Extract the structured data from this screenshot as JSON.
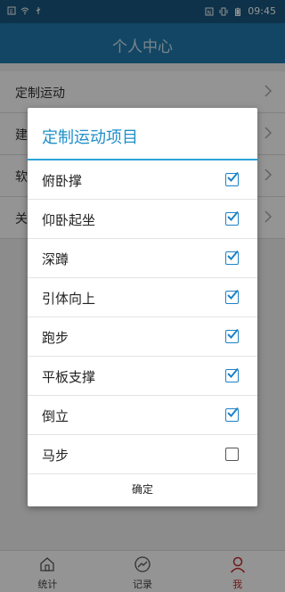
{
  "status_bar": {
    "time": "09:45",
    "icons": [
      "notification-icon",
      "wifi-icon",
      "usb-icon",
      "nfc-icon",
      "vibrate-icon",
      "battery-icon"
    ]
  },
  "header": {
    "title": "个人中心"
  },
  "settings": {
    "items": [
      {
        "label": "定制运动"
      },
      {
        "label": "建议反馈"
      },
      {
        "label": "软件更新"
      },
      {
        "label": "关于我们"
      }
    ]
  },
  "dialog": {
    "title": "定制运动项目",
    "options": [
      {
        "label": "俯卧撑",
        "checked": true
      },
      {
        "label": "仰卧起坐",
        "checked": true
      },
      {
        "label": "深蹲",
        "checked": true
      },
      {
        "label": "引体向上",
        "checked": true
      },
      {
        "label": "跑步",
        "checked": true
      },
      {
        "label": "平板支撑",
        "checked": true
      },
      {
        "label": "倒立",
        "checked": true
      },
      {
        "label": "马步",
        "checked": false
      }
    ],
    "confirm_label": "确定"
  },
  "bottom_nav": {
    "items": [
      {
        "label": "统计",
        "icon": "home-icon",
        "active": false
      },
      {
        "label": "记录",
        "icon": "trend-icon",
        "active": false
      },
      {
        "label": "我",
        "icon": "person-icon",
        "active": true
      }
    ],
    "active_color": "#c42a2a",
    "inactive_color": "#444444"
  },
  "colors": {
    "header": "#1f79ad",
    "accent": "#1f8fc8",
    "checkbox": "#1d82c5"
  }
}
